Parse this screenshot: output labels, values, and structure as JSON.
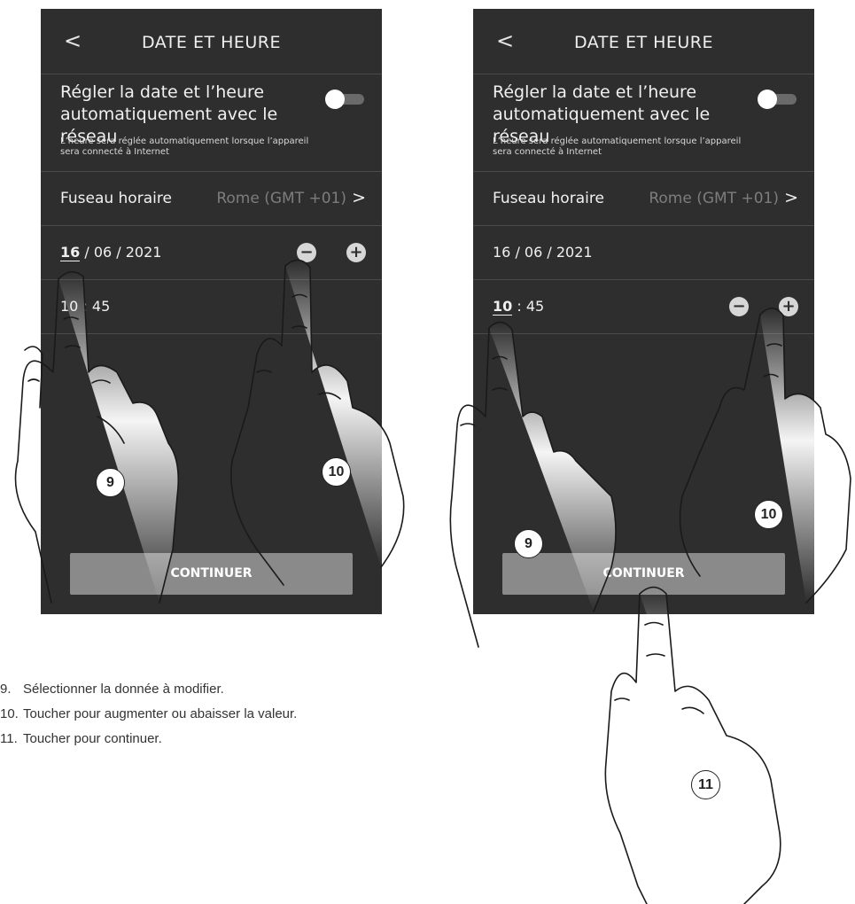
{
  "screens": [
    {
      "back_label": "<",
      "title": "DATE ET HEURE",
      "auto_setting": {
        "label": "Régler la date et l’heure automatiquement avec le réseau",
        "hint": "L’heure sera réglée automatiquement lorsque l’appareil sera connecté à Internet",
        "toggle_on": false
      },
      "timezone": {
        "label": "Fuseau horaire",
        "value": "Rome (GMT +01)",
        "chevron": ">"
      },
      "date": {
        "day": "16",
        "rest": " / 06 / 2021"
      },
      "time": {
        "hour": "10",
        "rest": " : 45"
      },
      "selected_field": "day",
      "continue_label": "CONTINUER"
    },
    {
      "back_label": "<",
      "title": "DATE ET HEURE",
      "auto_setting": {
        "label": "Régler la date et l’heure automatiquement avec le réseau",
        "hint": "L’heure sera réglée automatiquement lorsque l’appareil sera connecté à Internet",
        "toggle_on": false
      },
      "timezone": {
        "label": "Fuseau horaire",
        "value": "Rome (GMT +01)",
        "chevron": ">"
      },
      "date": {
        "day": "16",
        "rest": " / 06 / 2021"
      },
      "time": {
        "hour": "10",
        "rest": " : 45"
      },
      "selected_field": "hour",
      "continue_label": "CONTINUER"
    }
  ],
  "controls": {
    "minus": "−",
    "plus": "+"
  },
  "callouts": {
    "c9": "9",
    "c10": "10",
    "c11": "11"
  },
  "legend": [
    {
      "num": "9.",
      "text": "Sélectionner la donnée à modifier."
    },
    {
      "num": "10.",
      "text": "Toucher pour augmenter ou abaisser la valeur."
    },
    {
      "num": "11.",
      "text": "Toucher pour continuer."
    }
  ],
  "colors": {
    "screen_bg": "#2e2e2e",
    "divider": "#4a4a4a",
    "muted_text": "#7d7d7d",
    "button_bg": "#8a8a8a"
  }
}
